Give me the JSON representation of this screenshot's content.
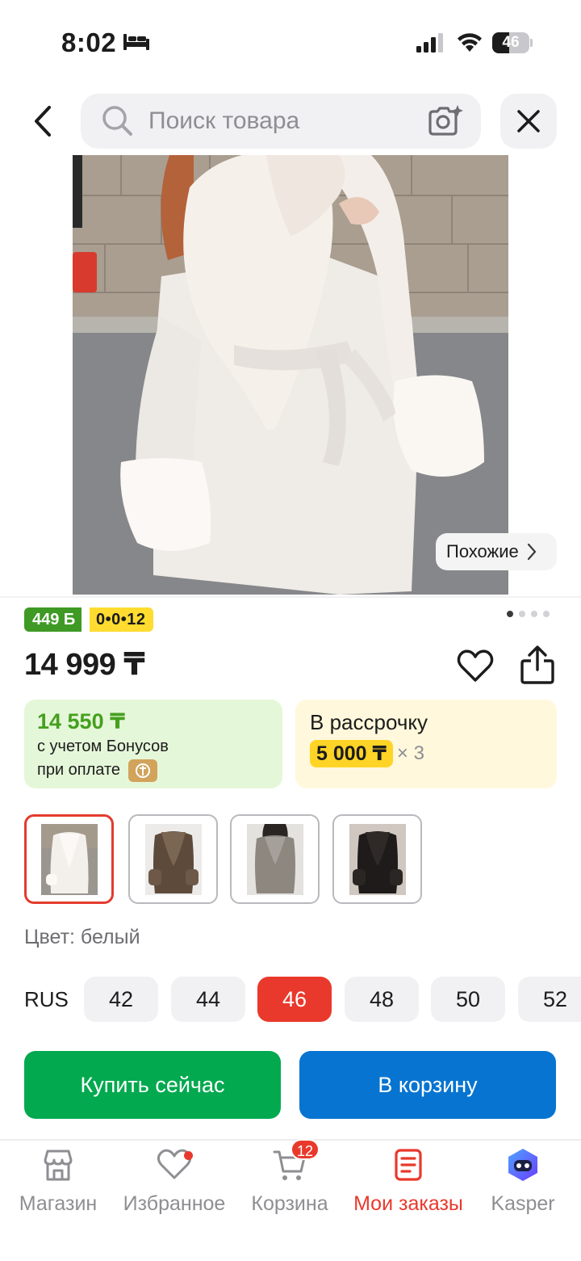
{
  "status_bar": {
    "time": "8:02",
    "battery": "46",
    "battery_level": 0.46
  },
  "search": {
    "placeholder": "Поиск товара"
  },
  "product": {
    "similar_label": "Похожие",
    "bonus_badge": "449 Б",
    "installment_badge": "0•0•12",
    "price": "14 999 ₸",
    "image_count": 4,
    "image_index": 1,
    "bonus_card": {
      "price": "14 550 ₸",
      "line1": "с учетом Бонусов",
      "line2": "при оплате"
    },
    "installment_card": {
      "title": "В рассрочку",
      "amount": "5 000 ₸",
      "times": "× 3"
    },
    "variants": [
      {
        "color": "white-icon",
        "selected": true
      },
      {
        "color": "brown-icon",
        "selected": false
      },
      {
        "color": "grey-icon",
        "selected": false
      },
      {
        "color": "black-icon",
        "selected": false
      }
    ],
    "color_label": "Цвет: белый",
    "size_system": "RUS",
    "sizes": [
      "42",
      "44",
      "46",
      "48",
      "50",
      "52"
    ],
    "selected_size": "46",
    "buy_label": "Купить сейчас",
    "cart_label": "В корзину"
  },
  "tabbar": {
    "items": [
      {
        "label": "Магазин",
        "icon": "store-icon"
      },
      {
        "label": "Избранное",
        "icon": "heart-icon"
      },
      {
        "label": "Корзина",
        "icon": "cart-icon"
      },
      {
        "label": "Мои заказы",
        "icon": "orders-icon"
      },
      {
        "label": "Kasper",
        "icon": "kasper-icon"
      }
    ],
    "active_index": 3,
    "cart_count": "12"
  },
  "colors": {
    "accent_red": "#e9392c",
    "buy_green": "#02a94f",
    "cart_blue": "#0774d1",
    "bonus_green": "#45a01f",
    "installment_yellow": "#ffd426"
  }
}
